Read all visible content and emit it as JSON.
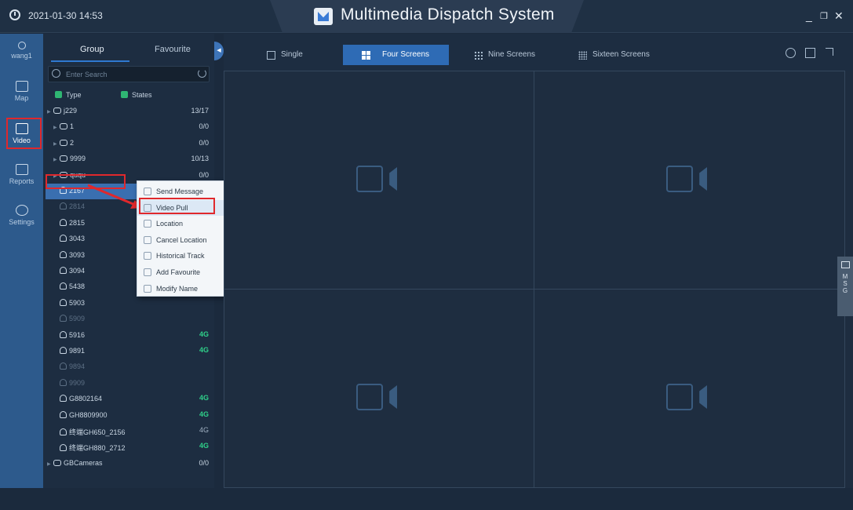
{
  "titlebar": {
    "datetime": "2021-01-30 14:53",
    "title": "Multimedia Dispatch System",
    "controls": [
      "_",
      "❐",
      "✕"
    ]
  },
  "user": {
    "name": "wang1"
  },
  "nav": [
    {
      "label": "Map",
      "icon": "map-icon"
    },
    {
      "label": "Video",
      "icon": "video-icon",
      "active": true
    },
    {
      "label": "Reports",
      "icon": "reports-icon"
    },
    {
      "label": "Settings",
      "icon": "settings-icon"
    }
  ],
  "panel": {
    "tabs": [
      "Group",
      "Favourite"
    ],
    "search_placeholder": "Enter Search",
    "filters": [
      "Type",
      "States"
    ],
    "tree": [
      {
        "label": "j229",
        "count": "13/17",
        "kind": "group",
        "level": 0
      },
      {
        "label": "1",
        "count": "0/0",
        "kind": "group",
        "level": 1
      },
      {
        "label": "2",
        "count": "0/0",
        "kind": "group",
        "level": 1
      },
      {
        "label": "9999",
        "count": "10/13",
        "kind": "group",
        "level": 1
      },
      {
        "label": "ququ",
        "count": "0/0",
        "kind": "group",
        "level": 1
      },
      {
        "label": "2167",
        "count": "",
        "kind": "user",
        "selected": true
      },
      {
        "label": "2814",
        "count": "",
        "kind": "user",
        "dim": true
      },
      {
        "label": "2815",
        "count": "",
        "kind": "user"
      },
      {
        "label": "3043",
        "count": "",
        "kind": "user"
      },
      {
        "label": "3093",
        "count": "",
        "kind": "user"
      },
      {
        "label": "3094",
        "count": "",
        "kind": "user"
      },
      {
        "label": "5438",
        "count": "",
        "kind": "user"
      },
      {
        "label": "5903",
        "count": "",
        "kind": "user"
      },
      {
        "label": "5909",
        "count": "",
        "kind": "user",
        "dim": true
      },
      {
        "label": "5916",
        "count": "4G",
        "kind": "user"
      },
      {
        "label": "9891",
        "count": "4G",
        "kind": "user"
      },
      {
        "label": "9894",
        "count": "",
        "kind": "user",
        "dim": true
      },
      {
        "label": "9909",
        "count": "",
        "kind": "user",
        "dim": true
      },
      {
        "label": "G8802164",
        "count": "4G",
        "kind": "user"
      },
      {
        "label": "GH8809900",
        "count": "4G",
        "kind": "user"
      },
      {
        "label": "终端GH650_2156",
        "count": "4G",
        "kind": "user",
        "gray": true
      },
      {
        "label": "终端GH880_2712",
        "count": "4G",
        "kind": "user"
      },
      {
        "label": "GBCameras",
        "count": "0/0",
        "kind": "group",
        "level": 0
      }
    ]
  },
  "context_menu": [
    {
      "label": "Send Message",
      "icon": "message-icon"
    },
    {
      "label": "Video Pull",
      "icon": "video-pull-icon",
      "highlighted": true
    },
    {
      "label": "Location",
      "icon": "location-icon"
    },
    {
      "label": "Cancel Location",
      "icon": "cancel-location-icon"
    },
    {
      "label": "Historical Track",
      "icon": "track-icon"
    },
    {
      "label": "Add Favourite",
      "icon": "star-icon"
    },
    {
      "label": "Modify Name",
      "icon": "pencil-icon"
    }
  ],
  "toolbar": {
    "views": [
      {
        "label": "Single"
      },
      {
        "label": "Four Screens",
        "active": true
      },
      {
        "label": "Nine Screens"
      },
      {
        "label": "Sixteen Screens"
      }
    ]
  },
  "msg_tab": {
    "label": "M S G"
  },
  "colors": {
    "accent": "#2e6bb5",
    "online": "#2fd08a",
    "highlight_box": "#e0282c"
  }
}
